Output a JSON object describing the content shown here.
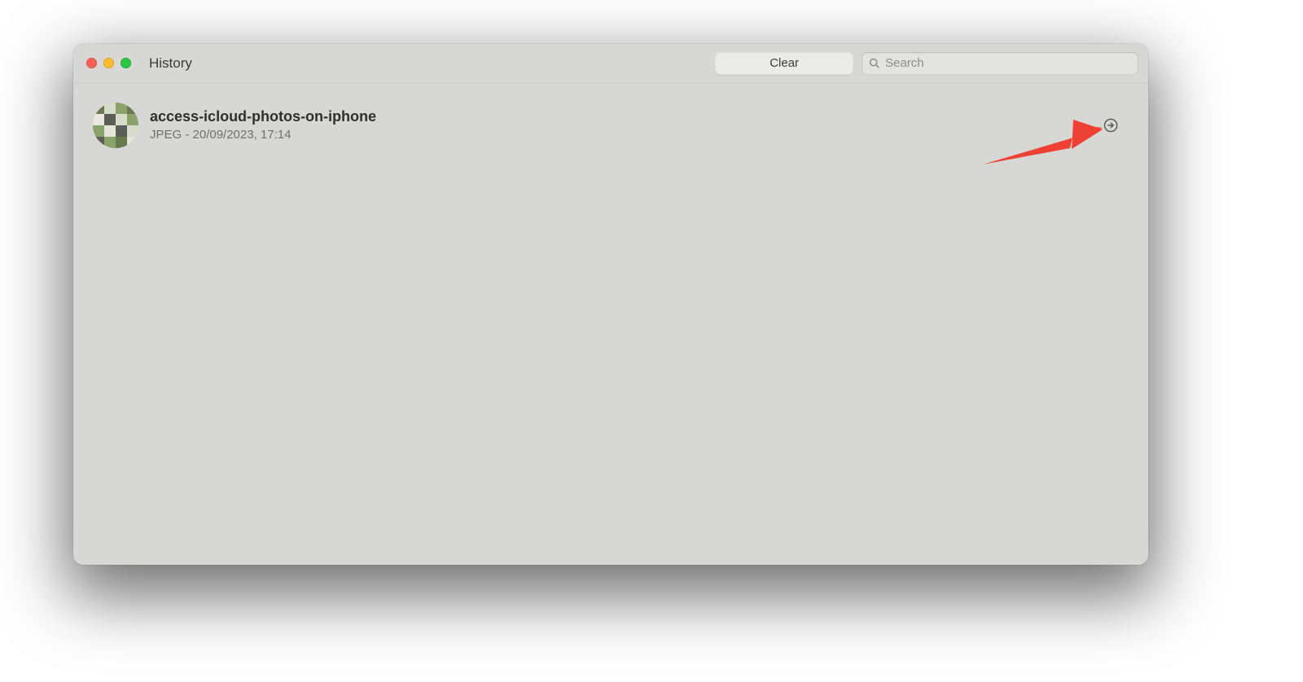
{
  "window": {
    "title": "History"
  },
  "toolbar": {
    "clear_label": "Clear",
    "search_placeholder": "Search"
  },
  "history": {
    "items": [
      {
        "title": "access-icloud-photos-on-iphone",
        "subtitle": "JPEG - 20/09/2023, 17:14"
      }
    ]
  }
}
